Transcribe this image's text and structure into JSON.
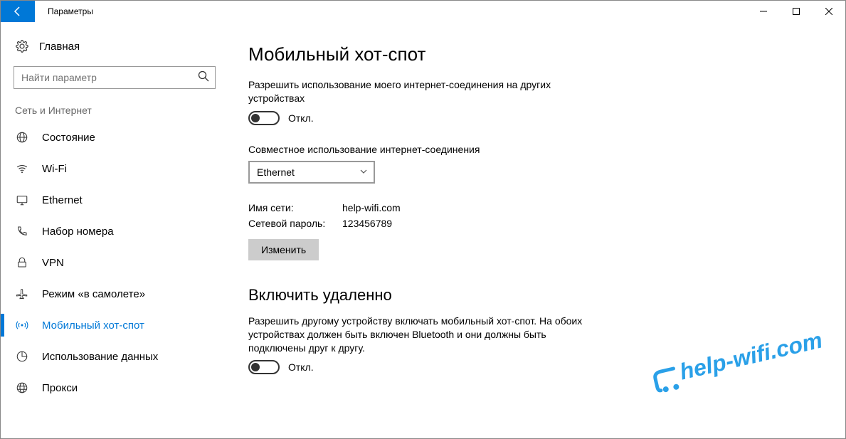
{
  "window": {
    "title": "Параметры"
  },
  "sidebar": {
    "home_label": "Главная",
    "search_placeholder": "Найти параметр",
    "group_title": "Сеть и Интернет",
    "items": [
      {
        "label": "Состояние"
      },
      {
        "label": "Wi-Fi"
      },
      {
        "label": "Ethernet"
      },
      {
        "label": "Набор номера"
      },
      {
        "label": "VPN"
      },
      {
        "label": "Режим «в самолете»"
      },
      {
        "label": "Мобильный хот-спот"
      },
      {
        "label": "Использование данных"
      },
      {
        "label": "Прокси"
      }
    ]
  },
  "main": {
    "title": "Мобильный хот-спот",
    "share_desc": "Разрешить использование моего интернет-соединения на других устройствах",
    "share_toggle_label": "Откл.",
    "connection_label": "Совместное использование интернет-соединения",
    "connection_value": "Ethernet",
    "net_name_label": "Имя сети:",
    "net_name_value": "help-wifi.com",
    "net_pass_label": "Сетевой пароль:",
    "net_pass_value": "123456789",
    "edit_btn": "Изменить",
    "remote_title": "Включить удаленно",
    "remote_desc": "Разрешить другому устройству включать мобильный хот-спот. На обоих устройствах должен быть включен Bluetooth и они должны быть подключены друг к другу.",
    "remote_toggle_label": "Откл."
  },
  "watermark": "help-wifi.com"
}
